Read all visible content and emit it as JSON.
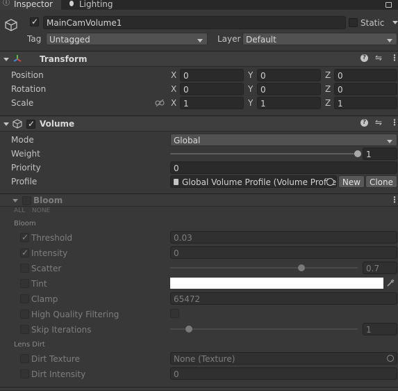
{
  "tabs": [
    {
      "label": "Inspector",
      "icon": "info-icon"
    },
    {
      "label": "Lighting",
      "icon": "lightbulb-icon"
    }
  ],
  "object": {
    "name": "MainCamVolume1",
    "active": true,
    "static_label": "Static",
    "static_checked": false,
    "tag_label": "Tag",
    "tag_value": "Untagged",
    "layer_label": "Layer",
    "layer_value": "Default"
  },
  "transform": {
    "title": "Transform",
    "rows": [
      {
        "label": "Position",
        "x": "0",
        "y": "0",
        "z": "0"
      },
      {
        "label": "Rotation",
        "x": "0",
        "y": "0",
        "z": "0"
      },
      {
        "label": "Scale",
        "x": "1",
        "y": "1",
        "z": "1"
      }
    ],
    "axis_labels": [
      "X",
      "Y",
      "Z"
    ]
  },
  "volume": {
    "title": "Volume",
    "enabled": true,
    "mode_label": "Mode",
    "mode_value": "Global",
    "weight_label": "Weight",
    "weight_value": "1",
    "weight_fraction": 1.0,
    "priority_label": "Priority",
    "priority_value": "0",
    "profile_label": "Profile",
    "profile_value": "Global Volume Profile (Volume Profile",
    "new_button": "New",
    "clone_button": "Clone"
  },
  "bloom": {
    "title": "Bloom",
    "all_label": "ALL",
    "none_label": "NONE",
    "section_bloom": "Bloom",
    "section_lens_dirt": "Lens Dirt",
    "rows": [
      {
        "label": "Threshold",
        "checked": true,
        "value": "0.03"
      },
      {
        "label": "Intensity",
        "checked": true,
        "value": "0"
      },
      {
        "label": "Scatter",
        "checked": false,
        "value": "0.7",
        "slider_fraction": 0.7
      },
      {
        "label": "Tint",
        "checked": false,
        "value": "",
        "color": "#ffffff"
      },
      {
        "label": "Clamp",
        "checked": false,
        "value": "65472"
      },
      {
        "label": "High Quality Filtering",
        "checked": false,
        "value": ""
      },
      {
        "label": "Skip Iterations",
        "checked": false,
        "value": "1",
        "slider_fraction": 0.1
      },
      {
        "label": "Dirt Texture",
        "checked": false,
        "value": "None (Texture)"
      },
      {
        "label": "Dirt Intensity",
        "checked": false,
        "value": "0"
      }
    ]
  },
  "colors": {
    "background": "#383838",
    "field": "#2a2a2a",
    "header": "#3e3e3e"
  }
}
